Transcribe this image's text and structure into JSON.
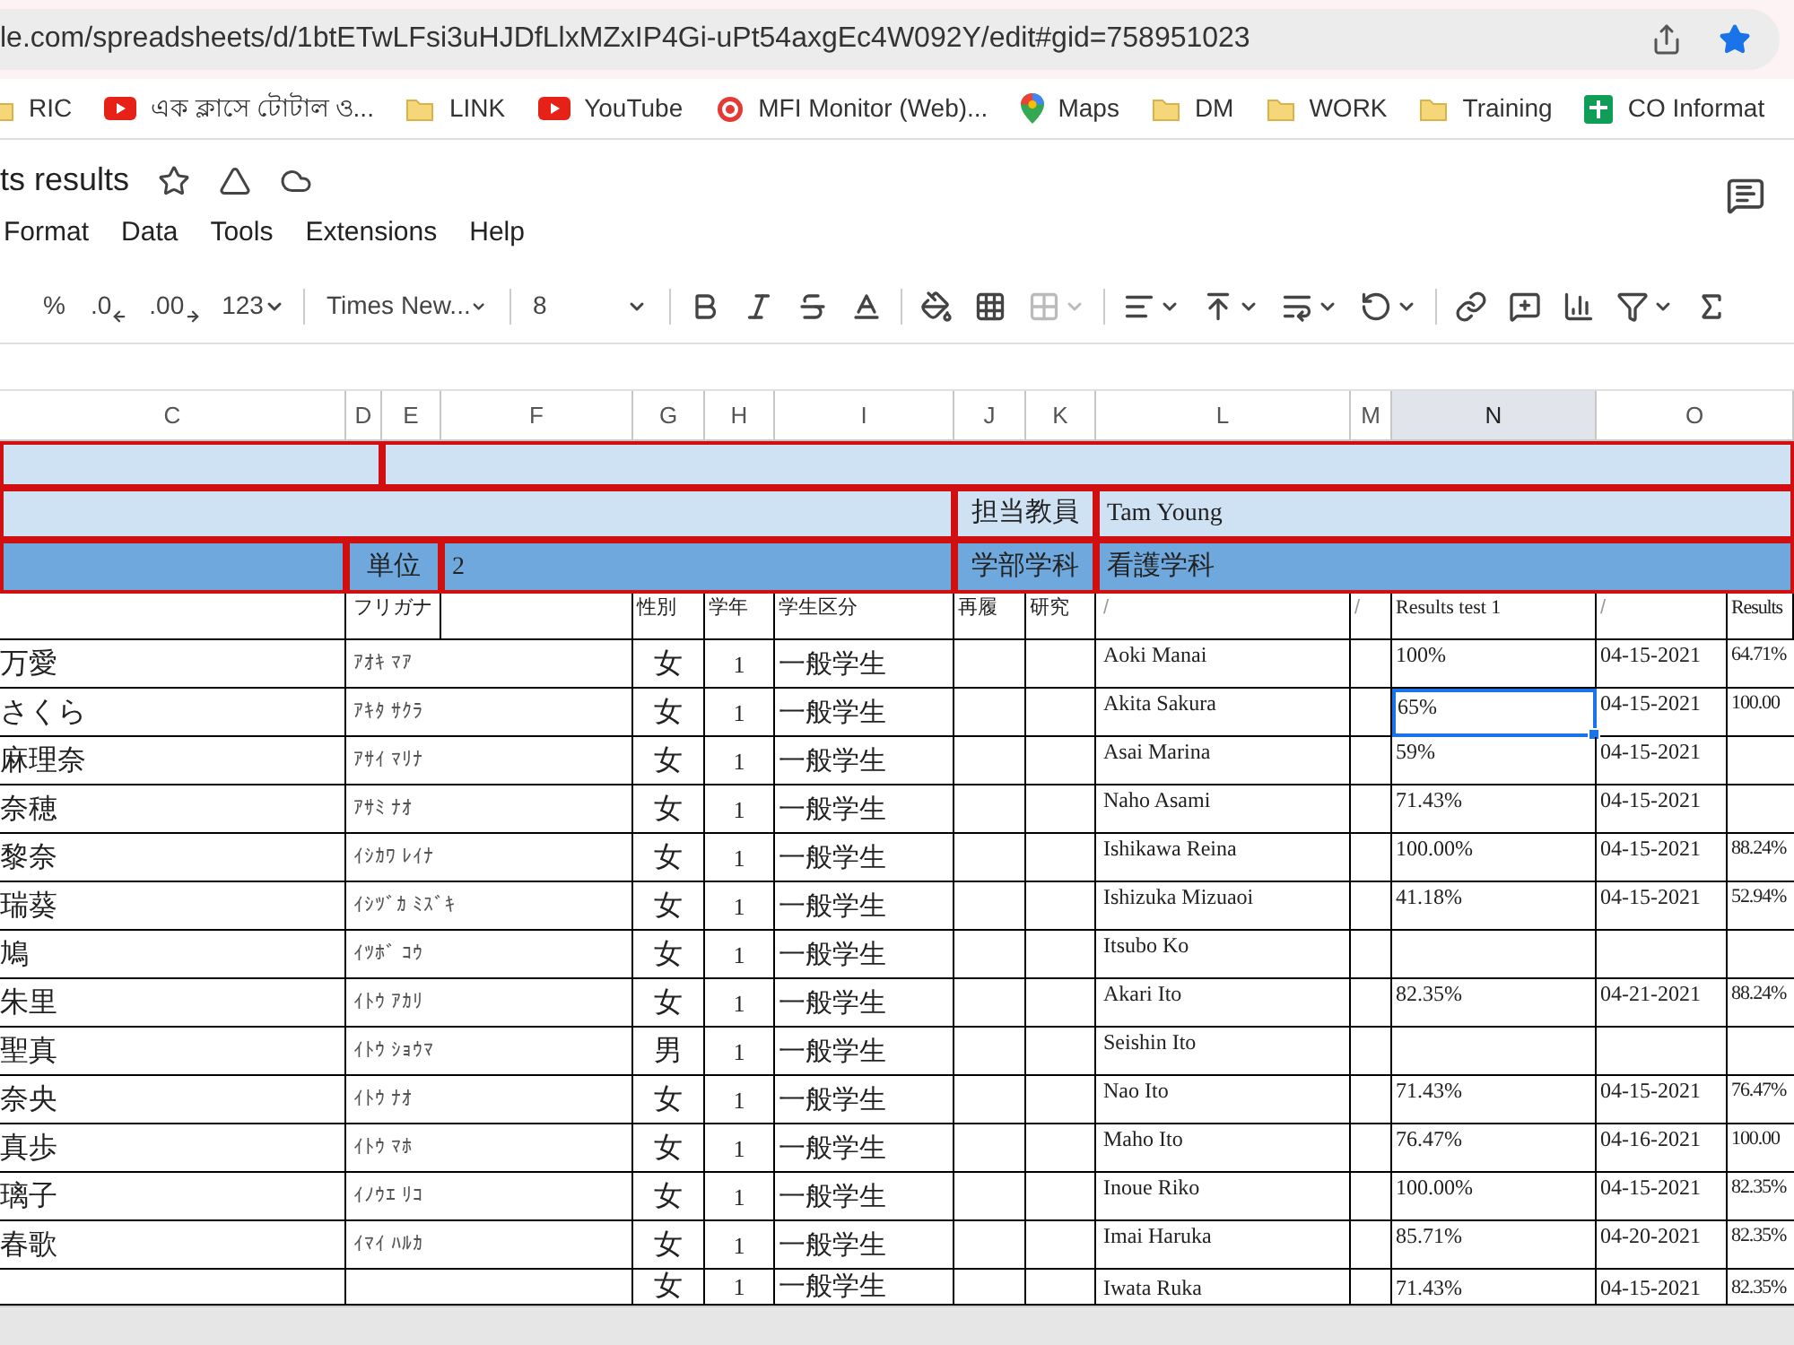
{
  "browser": {
    "url": "le.com/spreadsheets/d/1btETwLFsi3uHJDfLlxMZxIP4Gi-uPt54axgEc4W092Y/edit#gid=758951023",
    "bookmarks": [
      {
        "kind": "folder",
        "label": "RIC"
      },
      {
        "kind": "video",
        "label": "এক ক্লাসে টোটাল ও..."
      },
      {
        "kind": "folder",
        "label": "LINK"
      },
      {
        "kind": "video",
        "label": "YouTube"
      },
      {
        "kind": "target",
        "label": "MFI Monitor (Web)..."
      },
      {
        "kind": "pin",
        "label": "Maps"
      },
      {
        "kind": "folder",
        "label": "DM"
      },
      {
        "kind": "folder",
        "label": "WORK"
      },
      {
        "kind": "folder",
        "label": "Training"
      },
      {
        "kind": "sheet",
        "label": "CO Informat"
      }
    ]
  },
  "doc": {
    "title": "ts results",
    "menu": [
      "Format",
      "Data",
      "Tools",
      "Extensions",
      "Help"
    ]
  },
  "toolbar": {
    "percent": "%",
    "decrease_decimals": ".0",
    "increase_decimals": ".00",
    "format": "123",
    "font": "Times New...",
    "size": "8"
  },
  "columns": [
    {
      "label": "C",
      "selected": false
    },
    {
      "label": "D",
      "selected": false
    },
    {
      "label": "E",
      "selected": false
    },
    {
      "label": "F",
      "selected": false
    },
    {
      "label": "G",
      "selected": false
    },
    {
      "label": "H",
      "selected": false
    },
    {
      "label": "I",
      "selected": false
    },
    {
      "label": "J",
      "selected": false
    },
    {
      "label": "K",
      "selected": false
    },
    {
      "label": "L",
      "selected": false
    },
    {
      "label": "M",
      "selected": false
    },
    {
      "label": "N",
      "selected": true
    },
    {
      "label": "O",
      "selected": false
    }
  ],
  "info": {
    "teacher_label": "担当教員",
    "teacher": "Tam Young",
    "credits_label": "単位",
    "credits": "2",
    "department_label": "学部学科",
    "department": "看護学科"
  },
  "header": {
    "furigana": "フリガナ",
    "sex": "性別",
    "year": "学年",
    "type": "学生区分",
    "retake": "再履",
    "research": "研究",
    "col_l": "/",
    "col_m": "/",
    "test1": "Results test 1",
    "col_o": "/",
    "col_p": "Results"
  },
  "rows": [
    {
      "name": "万愛",
      "furigana": "ｱｵｷ ﾏｱ",
      "sex": "女",
      "year": "1",
      "type": "一般学生",
      "romaji": "Aoki Manai",
      "test1": "100%",
      "test1_selected": false,
      "date": "04-15-2021",
      "result": "64.71%"
    },
    {
      "name": "さくら",
      "furigana": "ｱｷﾀ ｻｸﾗ",
      "sex": "女",
      "year": "1",
      "type": "一般学生",
      "romaji": "Akita Sakura",
      "test1": "65%",
      "test1_selected": true,
      "date": "04-15-2021",
      "result": "100.00"
    },
    {
      "name": "麻理奈",
      "furigana": "ｱｻｲ ﾏﾘﾅ",
      "sex": "女",
      "year": "1",
      "type": "一般学生",
      "romaji": "Asai Marina",
      "test1": "59%",
      "test1_selected": false,
      "date": "04-15-2021"
    },
    {
      "name": "奈穂",
      "furigana": "ｱｻﾐ ﾅｵ",
      "sex": "女",
      "year": "1",
      "type": "一般学生",
      "romaji": "Naho Asami",
      "test1": "71.43%",
      "test1_selected": false,
      "date": "04-15-2021"
    },
    {
      "name": "黎奈",
      "furigana": "ｲｼｶﾜ ﾚｲﾅ",
      "sex": "女",
      "year": "1",
      "type": "一般学生",
      "romaji": "Ishikawa Reina",
      "test1": "100.00%",
      "test1_selected": false,
      "date": "04-15-2021",
      "result": "88.24%"
    },
    {
      "name": "瑞葵",
      "furigana": "ｲｼﾂﾞｶ ﾐｽﾞｷ",
      "sex": "女",
      "year": "1",
      "type": "一般学生",
      "romaji": "Ishizuka Mizuaoi",
      "test1": "41.18%",
      "test1_selected": false,
      "date": "04-15-2021",
      "result": "52.94%"
    },
    {
      "name": "鳩",
      "furigana": "ｲﾂﾎﾞ ｺｳ",
      "sex": "女",
      "year": "1",
      "type": "一般学生",
      "romaji": "Itsubo Ko",
      "test1_selected": false
    },
    {
      "name": "朱里",
      "furigana": "ｲﾄｳ ｱｶﾘ",
      "sex": "女",
      "year": "1",
      "type": "一般学生",
      "romaji": "Akari Ito",
      "test1": "82.35%",
      "test1_selected": false,
      "date": "04-21-2021",
      "result": "88.24%"
    },
    {
      "name": "聖真",
      "furigana": "ｲﾄｳ ｼｮｳﾏ",
      "sex": "男",
      "year": "1",
      "type": "一般学生",
      "romaji": "Seishin Ito",
      "test1_selected": false
    },
    {
      "name": "奈央",
      "furigana": "ｲﾄｳ ﾅｵ",
      "sex": "女",
      "year": "1",
      "type": "一般学生",
      "romaji": "Nao Ito",
      "test1": "71.43%",
      "test1_selected": false,
      "date": "04-15-2021",
      "result": "76.47%"
    },
    {
      "name": "真歩",
      "furigana": "ｲﾄｳ ﾏﾎ",
      "sex": "女",
      "year": "1",
      "type": "一般学生",
      "romaji": "Maho Ito",
      "test1": "76.47%",
      "test1_selected": false,
      "date": "04-16-2021",
      "result": "100.00"
    },
    {
      "name": "璃子",
      "furigana": "ｲﾉｳｴ ﾘｺ",
      "sex": "女",
      "year": "1",
      "type": "一般学生",
      "romaji": "Inoue Riko",
      "test1": "100.00%",
      "test1_selected": false,
      "date": "04-15-2021",
      "result": "82.35%"
    },
    {
      "name": "春歌",
      "furigana": "ｲﾏｲ ﾊﾙｶ",
      "sex": "女",
      "year": "1",
      "type": "一般学生",
      "romaji": "Imai Haruka",
      "test1": "85.71%",
      "test1_selected": false,
      "date": "04-20-2021",
      "result": "82.35%"
    },
    {
      "sex": "女",
      "year": "1",
      "type": "一般学生",
      "romaji": "Iwata Ruka",
      "test1": "71.43%",
      "test1_selected": false,
      "date": "04-15-2021",
      "result": "82.35%"
    }
  ]
}
